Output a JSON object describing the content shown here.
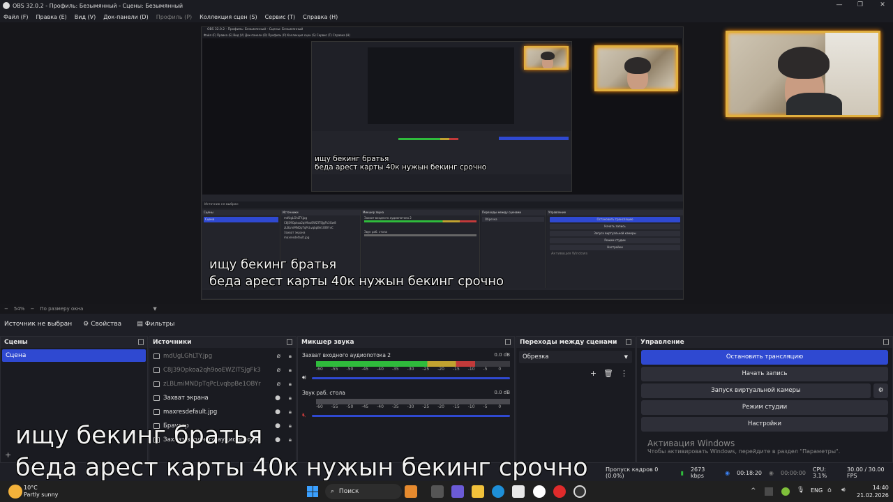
{
  "window": {
    "title": "OBS 32.0.2 - Профиль: Безымянный - Сцены: Безымянный",
    "minimize": "—",
    "maximize": "❐",
    "close": "✕"
  },
  "menu": [
    {
      "label": "Файл (F)",
      "enabled": true
    },
    {
      "label": "Правка (E)",
      "enabled": true
    },
    {
      "label": "Вид (V)",
      "enabled": true
    },
    {
      "label": "Док-панели (D)",
      "enabled": true
    },
    {
      "label": "Профиль (P)",
      "enabled": false
    },
    {
      "label": "Коллекция сцен (S)",
      "enabled": true
    },
    {
      "label": "Сервис (T)",
      "enabled": true
    },
    {
      "label": "Справка (H)",
      "enabled": true
    }
  ],
  "captions": {
    "line1": "ищу бекинг братья",
    "line2": "беда арест карты 40к нужын бекинг срочно"
  },
  "zoom": {
    "percent": "54%",
    "mode": "По размеру окна"
  },
  "source_bar": {
    "status": "Источник не выбран",
    "properties": "Свойства",
    "filters": "Фильтры"
  },
  "scenes": {
    "title": "Сцены",
    "items": [
      "Сцена"
    ]
  },
  "sources": {
    "title": "Источники",
    "items": [
      {
        "name": "mdUgLGhLTY.jpg",
        "hidden": true
      },
      {
        "name": "C8J39Opkoa2qh9ooEWZITSJgFk3Gw8",
        "hidden": true
      },
      {
        "name": "zLBLmiMNDpTqPcLvqbpBe1OBYrvC",
        "hidden": true
      },
      {
        "name": "Захват экрана",
        "hidden": false
      },
      {
        "name": "maxresdefault.jpg",
        "hidden": false
      },
      {
        "name": "Браузер",
        "hidden": false
      },
      {
        "name": "Захват входного аудиопотока 2",
        "hidden": false
      }
    ]
  },
  "mixer": {
    "title": "Микшер звука",
    "channels": [
      {
        "name": "Захват входного аудиопотока 2",
        "db": "0.0 dB",
        "level": 0.82
      },
      {
        "name": "Звук раб. стола",
        "db": "0.0 dB",
        "level": 0.0
      }
    ],
    "ticks": [
      "-60",
      "-55",
      "-50",
      "-45",
      "-40",
      "-35",
      "-30",
      "-25",
      "-20",
      "-15",
      "-10",
      "-5",
      "0"
    ]
  },
  "transitions": {
    "title": "Переходы между сценами",
    "selected": "Обрезка"
  },
  "controls": {
    "title": "Управление",
    "stop_stream": "Остановить трансляцию",
    "start_record": "Начать запись",
    "virtual_cam": "Запуск виртуальной камеры",
    "studio_mode": "Режим студии",
    "settings": "Настройки"
  },
  "activation": {
    "title": "Активация Windows",
    "subtitle": "Чтобы активировать Windows, перейдите в раздел \"Параметры\"."
  },
  "status": {
    "dropped": "Пропуск кадров 0 (0.0%)",
    "kbps": "2673 kbps",
    "stream_time": "00:18:20",
    "rec_time": "00:00:00",
    "cpu": "CPU: 3.1%",
    "fps": "30.00 / 30.00 FPS"
  },
  "taskbar": {
    "weather_temp": "10°C",
    "weather_desc": "Partly sunny",
    "search": "Поиск",
    "lang": "ENG",
    "time": "14:40",
    "date": "21.02.2026"
  },
  "nested": {
    "title": "OBS 32.0.2 - Профиль: Безымянный - Сцены: Безымянный",
    "menu": "Файл (F)   Правка (E)   Вид (V)   Док-панели (D)   Профиль (P)   Коллекция сцен (S)   Сервис (T)   Справка (H)",
    "source_status": "Источник не выбран",
    "docks": [
      "Сцены",
      "Источники",
      "Микшер звука",
      "Переходы между сценами",
      "Управление"
    ],
    "stop_stream": "Остановить трансляцию",
    "buttons": [
      "Начать запись",
      "Запуск виртуальной камеры",
      "Режим студии",
      "Настройки"
    ],
    "activation": "Активация Windows",
    "scene_item": "Сцена",
    "transition": "Обрезка"
  },
  "colors": {
    "accent": "#2f49d1",
    "meter_green": "#2fbb3c",
    "meter_yellow": "#c1a230",
    "meter_red": "#c23a3a",
    "cam_border": "#e0b040"
  },
  "icons": [
    "obs-logo-icon",
    "gear-icon",
    "filter-icon",
    "eye-icon",
    "lock-icon",
    "plus-icon",
    "trash-icon",
    "more-icon",
    "windows-icon",
    "search-icon",
    "chevron-down-icon"
  ]
}
